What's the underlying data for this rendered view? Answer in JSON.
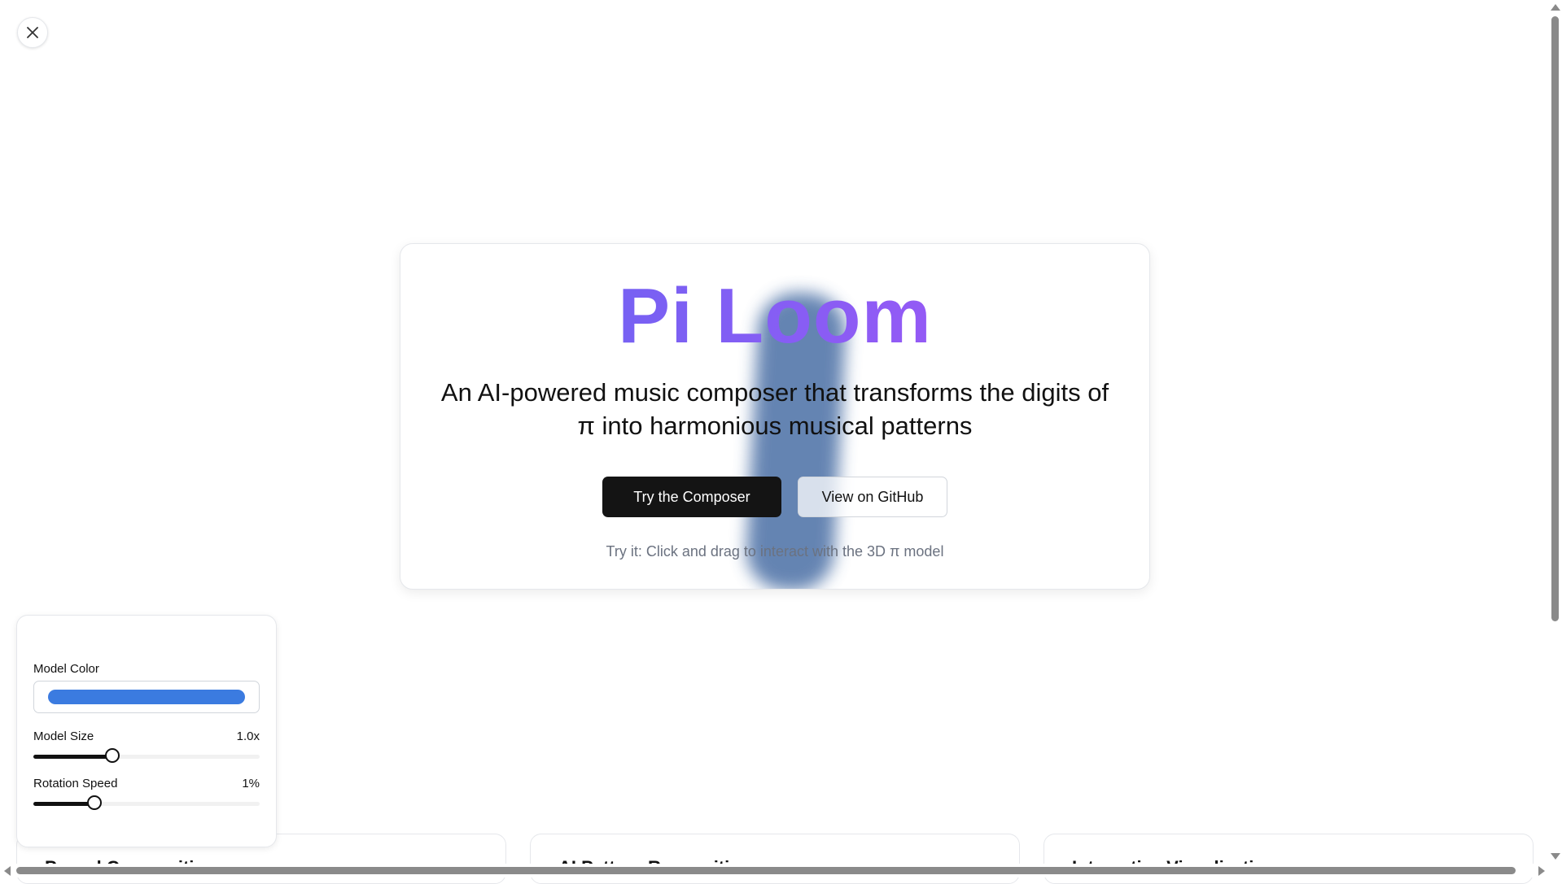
{
  "close_button": {
    "icon": "close-icon"
  },
  "hero": {
    "title": "Pi Loom",
    "subtitle": "An AI-powered music composer that transforms the digits of π into harmonious musical patterns",
    "primary_button": "Try the Composer",
    "secondary_button": "View on GitHub",
    "hint": "Try it: Click and drag to interact with the 3D π model",
    "title_gradient": [
      "#6366f1",
      "#a855f7"
    ],
    "model_color": "#4a6fa5"
  },
  "controls": {
    "color_label": "Model Color",
    "color_value": "#3b7be0",
    "size_label": "Model Size",
    "size_value_text": "1.0x",
    "size_level": 0.35,
    "speed_label": "Rotation Speed",
    "speed_value_text": "1%",
    "speed_level": 0.27
  },
  "features": [
    {
      "title": "Pascal Composition"
    },
    {
      "title": "AI Pattern Recognition"
    },
    {
      "title": "Interactive Visualization"
    }
  ],
  "scrollbars": {
    "vertical_thumb_color": "#8a8a8a",
    "horizontal_thumb_color": "#8a8a8a"
  }
}
